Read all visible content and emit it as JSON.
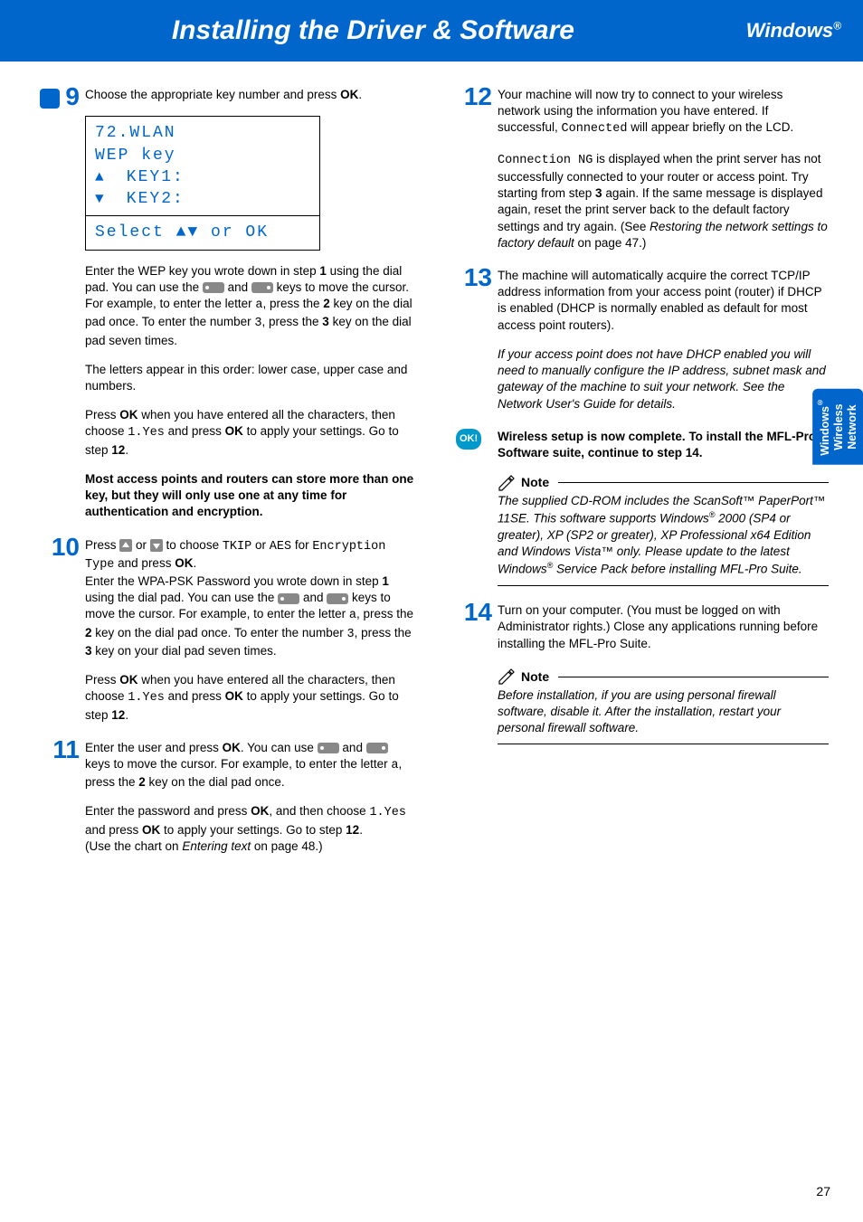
{
  "header": {
    "title": "Installing the Driver & Software",
    "platform": "Windows",
    "reg": "®"
  },
  "sidetab": {
    "l1": "Windows",
    "reg": "®",
    "l2": "Wireless",
    "l3": "Network"
  },
  "page_number": "27",
  "lcd": {
    "l1": "72.WLAN",
    "l2": "  WEP key",
    "l3_arrow": "▲",
    "l3": "   KEY1:",
    "l4_arrow": "▼",
    "l4": "   KEY2:",
    "select": "Select ▲▼ or OK"
  },
  "s9": {
    "num": "9",
    "p1a": "Choose the appropriate key number and press ",
    "p1b": "OK",
    "p1c": ".",
    "p2a": "Enter the WEP key you wrote down in step ",
    "p2b": "1",
    "p2c": " using the dial pad. You can use the ",
    "p2d": " and ",
    "p2e": " keys to move the cursor. For example, to enter the letter ",
    "p2f": "a",
    "p2g": ", press the ",
    "p2h": "2",
    "p2i": " key on the dial pad once. To enter the number ",
    "p2j": "3",
    "p2k": ", press the ",
    "p2l": "3",
    "p2m": " key on the dial pad seven times.",
    "p3": "The letters appear in this order: lower case, upper case and numbers.",
    "p4a": "Press ",
    "p4b": "OK",
    "p4c": " when you have entered all the characters, then choose ",
    "p4d": "1.Yes",
    "p4e": " and press ",
    "p4f": "OK",
    "p4g": " to apply your settings. Go to step ",
    "p4h": "12",
    "p4i": ".",
    "p5": "Most access points and routers can store more than one key, but they will only use one at any time for authentication and encryption."
  },
  "s10": {
    "num": "10",
    "p1a": "Press ",
    "p1b": " or ",
    "p1c": " to choose ",
    "p1d": "TKIP",
    "p1e": " or ",
    "p1f": "AES",
    "p1g": " for ",
    "p1h": "Encryption Type",
    "p1i": " and press ",
    "p1j": "OK",
    "p1k": ".",
    "p2a": "Enter the WPA-PSK Password you wrote down in step ",
    "p2b": "1",
    "p2c": " using the dial pad. You can use the ",
    "p2d": " and ",
    "p2e": " keys to move the cursor. For example, to enter the letter ",
    "p2f": "a",
    "p2g": ", press the ",
    "p2h": "2",
    "p2i": " key on the dial pad once. To enter the number ",
    "p2j": "3",
    "p2k": ", press the ",
    "p2l": "3",
    "p2m": " key on your dial pad seven times.",
    "p3a": "Press ",
    "p3b": "OK",
    "p3c": " when you have entered all the characters, then choose ",
    "p3d": "1.Yes",
    "p3e": " and press ",
    "p3f": "OK",
    "p3g": " to apply your settings. Go to step ",
    "p3h": "12",
    "p3i": "."
  },
  "s11": {
    "num": "11",
    "p1a": "Enter the user and press ",
    "p1b": "OK",
    "p1c": ". You can use ",
    "p1d": " and ",
    "p1e": " keys to move the cursor. For example, to enter the letter ",
    "p1f": "a",
    "p1g": ", press the ",
    "p1h": "2",
    "p1i": " key on the dial pad once.",
    "p2a": "Enter the password and press ",
    "p2b": "OK",
    "p2c": ", and then choose ",
    "p2d": "1.Yes",
    "p2e": " and press ",
    "p2f": "OK",
    "p2g": " to apply your settings. Go to step ",
    "p2h": "12",
    "p2i": ".",
    "p3a": "(Use the chart on ",
    "p3b": "Entering text",
    "p3c": " on page 48.)"
  },
  "s12": {
    "num": "12",
    "p1a": "Your machine will now try to connect to your wireless network using the information you have entered. If successful, ",
    "p1b": "Connected",
    "p1c": " will appear briefly on the LCD.",
    "p2a": "Connection NG",
    "p2b": " is displayed when the print server has not successfully connected to your router or access point. Try starting from step ",
    "p2c": "3",
    "p2d": " again. If the same message is displayed again, reset the print server back to the default factory settings and try again. (See ",
    "p2e": "Restoring the network settings to factory default",
    "p2f": " on page 47.)"
  },
  "s13": {
    "num": "13",
    "p1": "The machine will automatically acquire the correct TCP/IP address information from your access point (router) if DHCP is enabled (DHCP is normally enabled as default for most access point routers).",
    "p2": "If your access point does not have DHCP enabled you will need to manually configure the IP address, subnet mask and gateway of the machine to suit your network. See the Network User's Guide for details."
  },
  "ok_callout": {
    "badge": "OK!",
    "text": "Wireless setup is now complete. To install the MFL-Pro Software suite, continue to step 14."
  },
  "note1": {
    "title": "Note",
    "t1": "The supplied CD-ROM includes the ScanSoft™ PaperPort™ 11SE. This software supports Windows",
    "t2": " 2000 (SP4 or greater), XP (SP2 or greater), XP Professional x64 Edition and Windows Vista™ only. Please update to the latest Windows",
    "t3": " Service Pack before installing  MFL-Pro Suite.",
    "reg": "®"
  },
  "s14": {
    "num": "14",
    "p1": "Turn on your computer. (You must be logged on with Administrator rights.) Close any applications running before installing the MFL-Pro Suite."
  },
  "note2": {
    "title": "Note",
    "text": "Before installation, if you are using personal firewall software, disable it. After the installation, restart your personal firewall software."
  }
}
